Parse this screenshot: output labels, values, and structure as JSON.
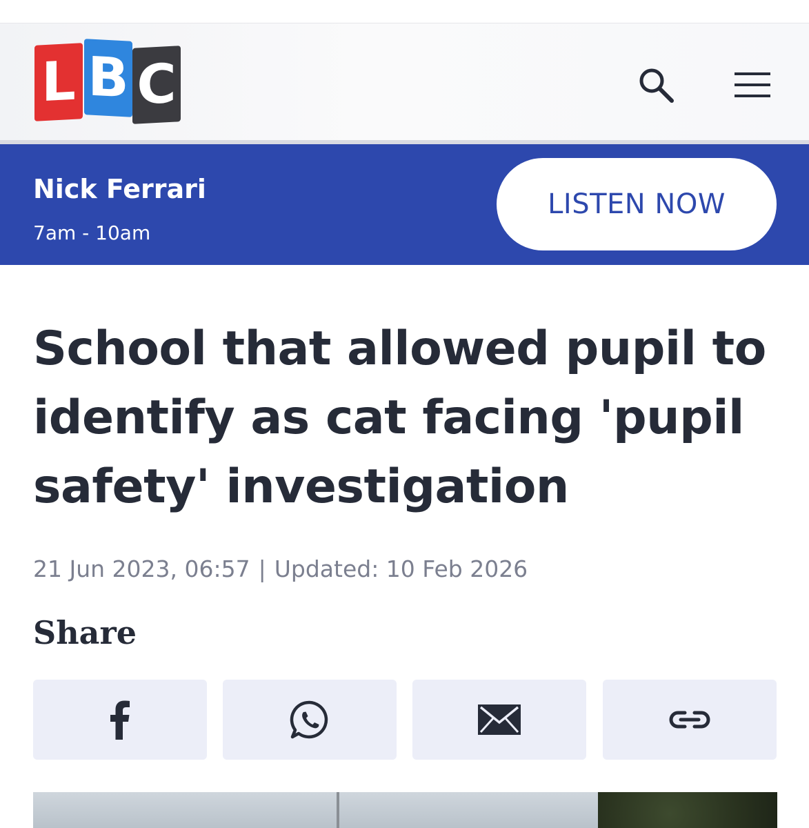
{
  "header": {
    "logo_letters": [
      "L",
      "B",
      "C"
    ],
    "search_icon": "search-icon",
    "menu_icon": "hamburger-menu-icon"
  },
  "live_banner": {
    "host": "Nick Ferrari",
    "time": "7am - 10am",
    "listen_label": "LISTEN NOW"
  },
  "article": {
    "headline": "School that allowed pupil to identify as cat facing 'pupil safety' investigation",
    "published": "21 Jun 2023, 06:57",
    "separator": "|",
    "updated": "Updated: 10 Feb 2026",
    "share_label": "Share",
    "share_buttons": [
      {
        "icon": "facebook-icon"
      },
      {
        "icon": "whatsapp-icon"
      },
      {
        "icon": "email-icon"
      },
      {
        "icon": "link-icon"
      }
    ]
  },
  "colors": {
    "brand_blue": "#2d48ad",
    "logo_red": "#e33131",
    "logo_blue": "#2f86de",
    "logo_dark": "#3b3b40",
    "share_bg": "#eceef8"
  }
}
